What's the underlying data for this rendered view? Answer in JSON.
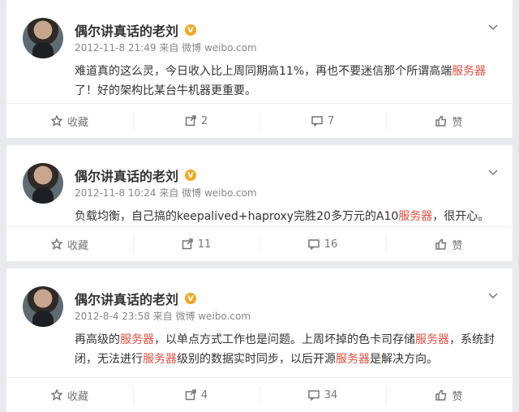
{
  "colors": {
    "highlight": "#eb4d3d",
    "verify": "#f6a623"
  },
  "posts": [
    {
      "name": "偶尔讲真话的老刘",
      "verify_icon": "V",
      "meta": "2012-11-8 21:49 来自 微博 weibo.com",
      "content_parts": [
        {
          "t": "难道真的这么灵，今日收入比上周同期高11%，再也不要迷信那个所谓高端"
        },
        {
          "t": "服务器",
          "hl": true
        },
        {
          "t": "了！好的架构比某台牛机器更重要。"
        }
      ],
      "actions": {
        "fav": "收藏",
        "forward": "2",
        "comment": "7",
        "like": "赞"
      }
    },
    {
      "name": "偶尔讲真话的老刘",
      "verify_icon": "V",
      "meta": "2012-11-8 10:24 来自 微博 weibo.com",
      "content_parts": [
        {
          "t": "负载均衡，自己搞的keepalived+haproxy完胜20多万元的A10"
        },
        {
          "t": "服务器",
          "hl": true
        },
        {
          "t": "，很开心。"
        }
      ],
      "actions": {
        "fav": "收藏",
        "forward": "11",
        "comment": "16",
        "like": "赞"
      }
    },
    {
      "name": "偶尔讲真话的老刘",
      "verify_icon": "V",
      "meta": "2012-8-4 23:58 来自 微博 weibo.com",
      "content_parts": [
        {
          "t": "再高级的"
        },
        {
          "t": "服务器",
          "hl": true
        },
        {
          "t": "，以单点方式工作也是问题。上周坏掉的色卡司存储"
        },
        {
          "t": "服务器",
          "hl": true
        },
        {
          "t": "，系统封闭，无法进行"
        },
        {
          "t": "服务器",
          "hl": true
        },
        {
          "t": "级别的数据实时同步，以后开源"
        },
        {
          "t": "服务器",
          "hl": true
        },
        {
          "t": "是解决方向。"
        }
      ],
      "actions": {
        "fav": "收藏",
        "forward": "4",
        "comment": "34",
        "like": "赞"
      }
    }
  ]
}
